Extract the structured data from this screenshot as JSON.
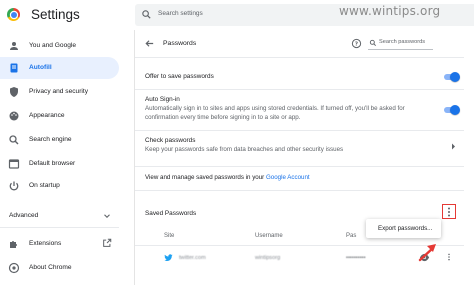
{
  "app": {
    "title": "Settings"
  },
  "search": {
    "placeholder": "Search settings"
  },
  "watermark": "www.wintips.org",
  "sidebar": {
    "items": [
      {
        "label": "You and Google",
        "icon": "person-icon"
      },
      {
        "label": "Autofill",
        "icon": "autofill-icon",
        "active": true
      },
      {
        "label": "Privacy and security",
        "icon": "shield-icon"
      },
      {
        "label": "Appearance",
        "icon": "palette-icon"
      },
      {
        "label": "Search engine",
        "icon": "search-icon"
      },
      {
        "label": "Default browser",
        "icon": "browser-icon"
      },
      {
        "label": "On startup",
        "icon": "power-icon"
      }
    ],
    "advanced_label": "Advanced",
    "extensions_label": "Extensions",
    "about_label": "About Chrome"
  },
  "passwords": {
    "title": "Passwords",
    "search_placeholder": "Search passwords",
    "offer_label": "Offer to save passwords",
    "autosignin_label": "Auto Sign-in",
    "autosignin_desc_1": "Automatically sign in to sites and apps using stored credentials. If turned off, you'll be asked for",
    "autosignin_desc_2": "confirmation every time before signing in to a site or app.",
    "check_label": "Check passwords",
    "check_desc": "Keep your passwords safe from data breaches and other security issues",
    "manage_prefix": "View and manage saved passwords in your ",
    "manage_link": "Google Account",
    "saved_label": "Saved Passwords",
    "columns": {
      "site": "Site",
      "username": "Username",
      "password": "Pas"
    },
    "entry": {
      "site": "twitter.com",
      "username": "wintipsorg",
      "password": "••••••••••"
    },
    "menu_item": "Export passwords..."
  },
  "colors": {
    "accent": "#1a73e8",
    "highlight": "#e53935",
    "active_bg": "#e8f0fe"
  }
}
